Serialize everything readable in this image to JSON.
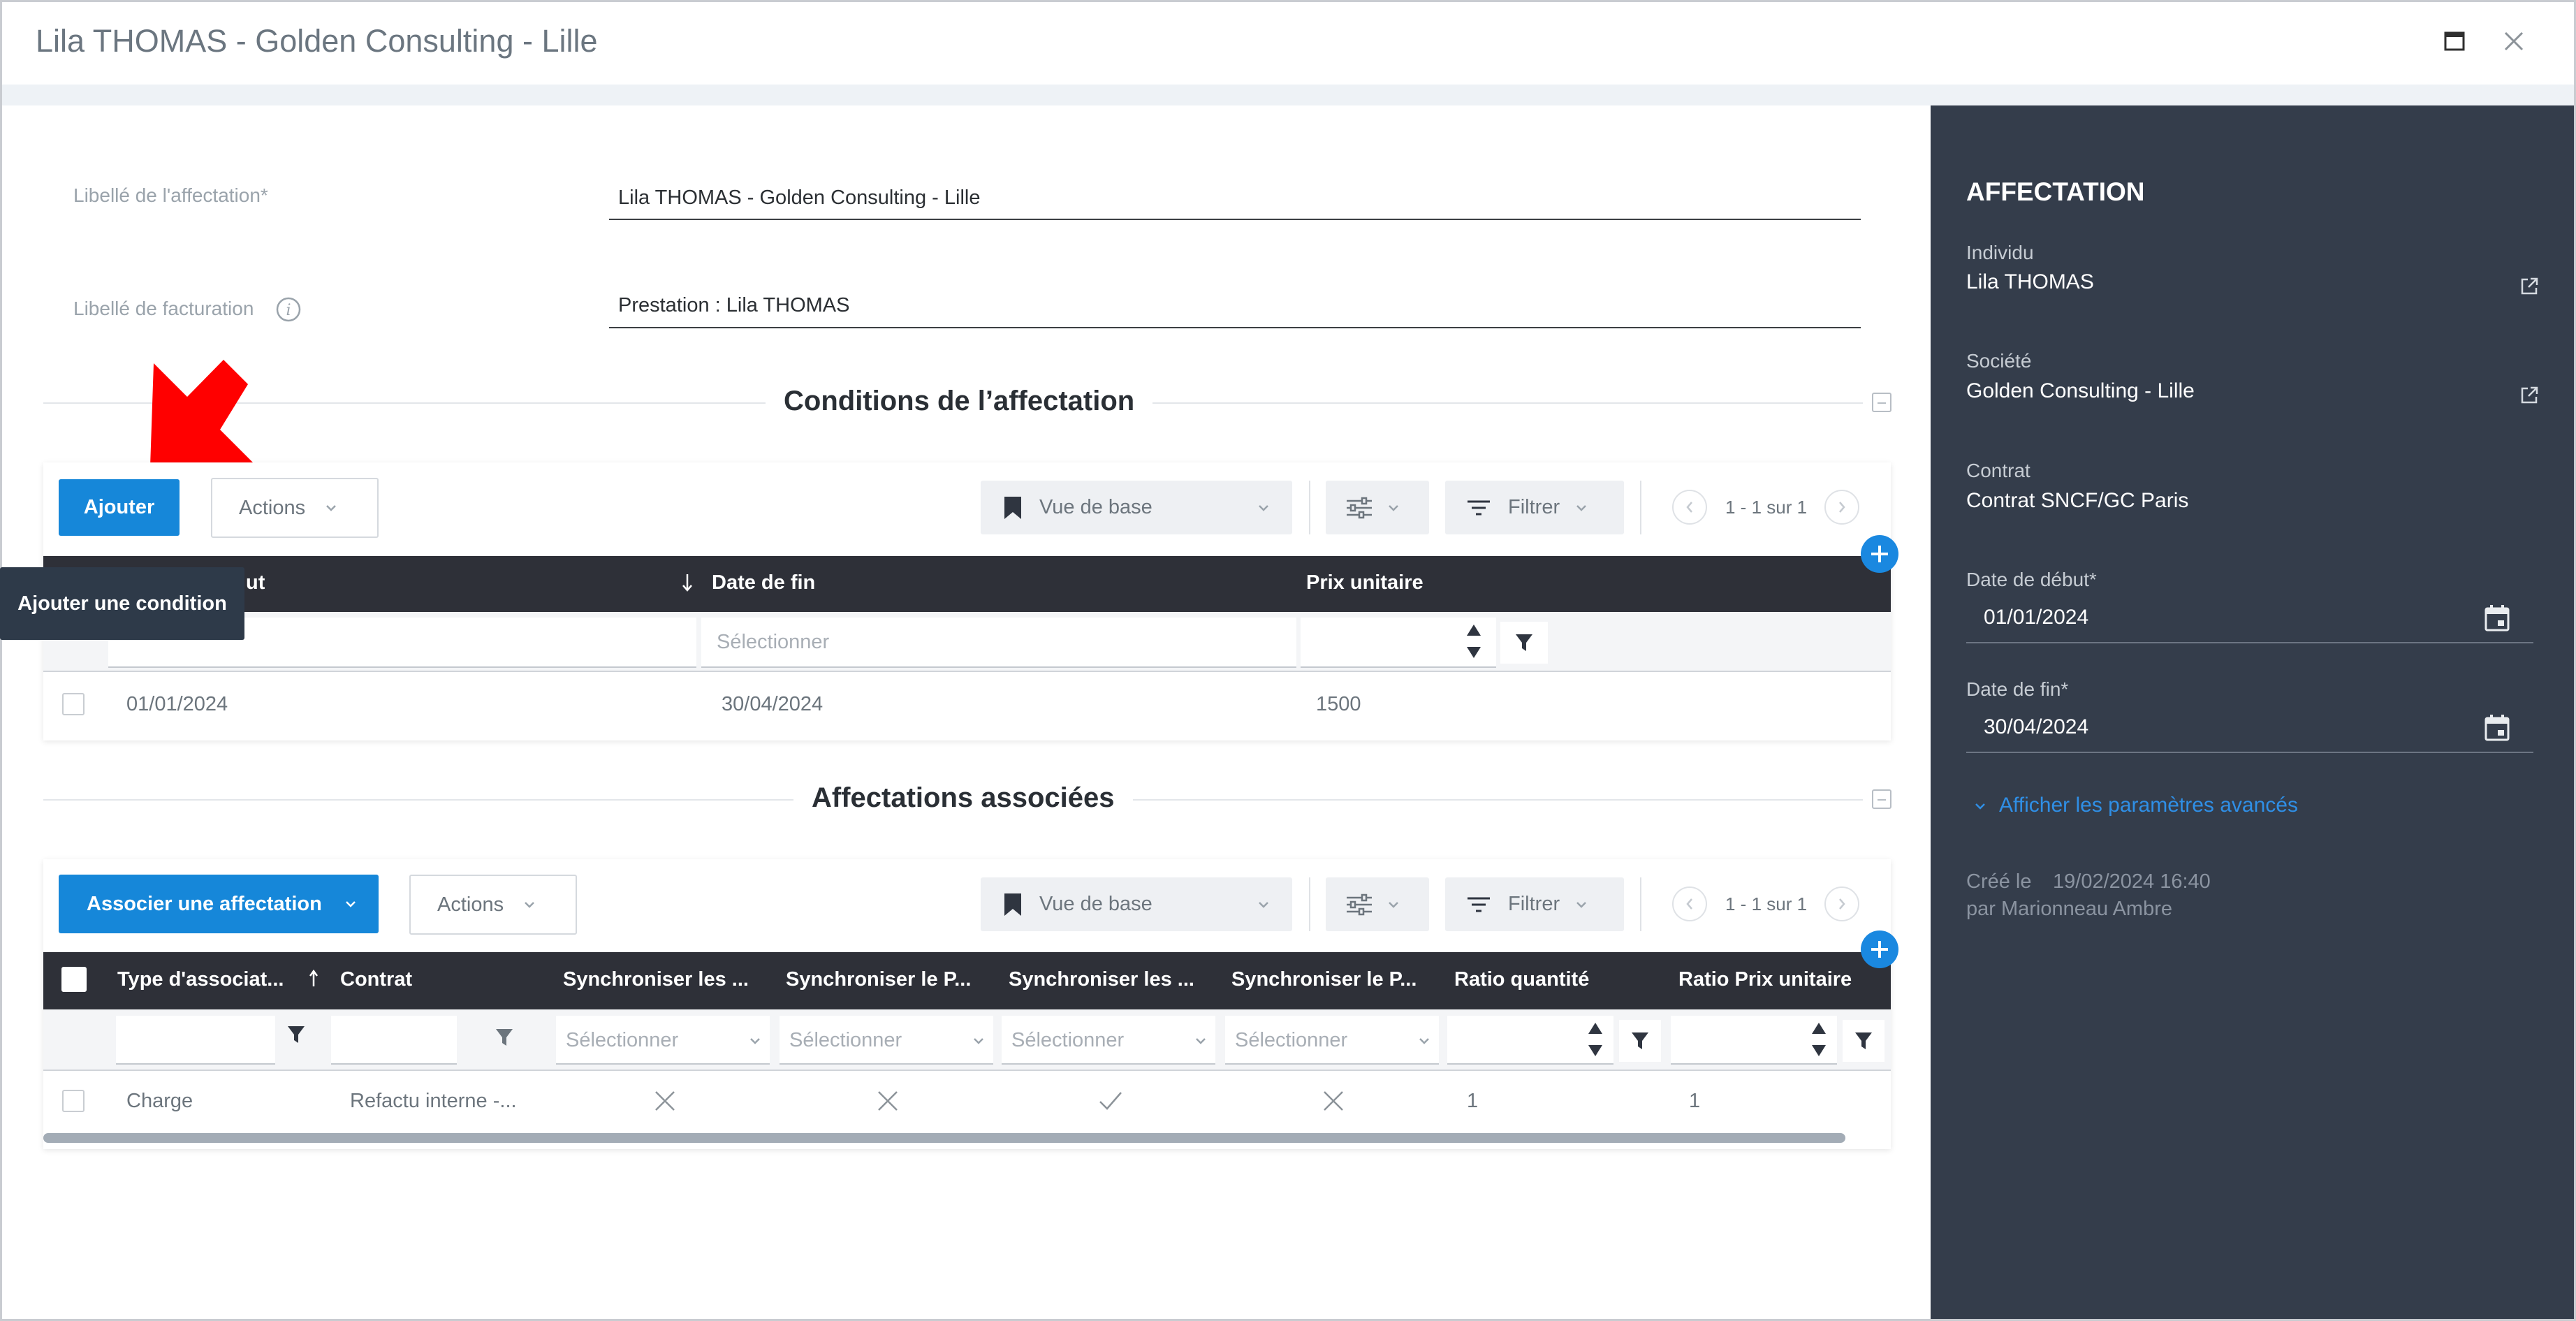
{
  "window": {
    "title": "Lila THOMAS - Golden Consulting - Lille"
  },
  "form": {
    "libelle_affectation_label": "Libellé de l'affectation*",
    "libelle_affectation_value": "Lila THOMAS - Golden Consulting - Lille",
    "libelle_facturation_label": "Libellé de facturation",
    "libelle_facturation_value": "Prestation : Lila THOMAS"
  },
  "conditions": {
    "section_title": "Conditions de l’affectation",
    "add_label": "Ajouter",
    "actions_label": "Actions",
    "view_label": "Vue de base",
    "filter_label": "Filtrer",
    "pagination": "1 - 1 sur 1",
    "tooltip": "Ajouter une condition",
    "columns": [
      "ut",
      "Date de fin",
      "Prix unitaire"
    ],
    "filter_placeholders": [
      "Sélectionner",
      "Sélectionner"
    ],
    "rows": [
      {
        "date_debut": "01/01/2024",
        "date_fin": "30/04/2024",
        "prix": "1500"
      }
    ]
  },
  "associees": {
    "section_title": "Affectations associées",
    "add_label": "Associer une affectation",
    "actions_label": "Actions",
    "view_label": "Vue de base",
    "filter_label": "Filtrer",
    "pagination": "1 - 1 sur 1",
    "columns": [
      "Type d'associat...",
      "Contrat",
      "Synchroniser les ...",
      "Synchroniser le P...",
      "Synchroniser les ...",
      "Synchroniser le P...",
      "Ratio quantité",
      "Ratio Prix unitaire"
    ],
    "filter_placeholder": "Sélectionner",
    "rows": [
      {
        "type": "Charge",
        "contrat": "Refactu interne -...",
        "sync1": "cross",
        "sync2": "cross",
        "sync3": "check",
        "sync4": "cross",
        "ratio_qte": "1",
        "ratio_prix": "1"
      }
    ]
  },
  "sidebar": {
    "title": "AFFECTATION",
    "individu_label": "Individu",
    "individu_value": "Lila THOMAS",
    "societe_label": "Société",
    "societe_value": "Golden Consulting - Lille",
    "contrat_label": "Contrat",
    "contrat_value": "Contrat SNCF/GC Paris",
    "date_debut_label": "Date de début*",
    "date_debut_value": "01/01/2024",
    "date_fin_label": "Date de fin*",
    "date_fin_value": "30/04/2024",
    "advanced_link": "Afficher les paramètres avancés",
    "created_label": "Créé le",
    "created_value": "19/02/2024 16:40",
    "created_by": "par Marionneau Ambre"
  },
  "colors": {
    "primary": "#1687d9",
    "dark_header": "#2e3038",
    "sidebar_bg": "#343d4b",
    "arrow": "#ff0000"
  }
}
